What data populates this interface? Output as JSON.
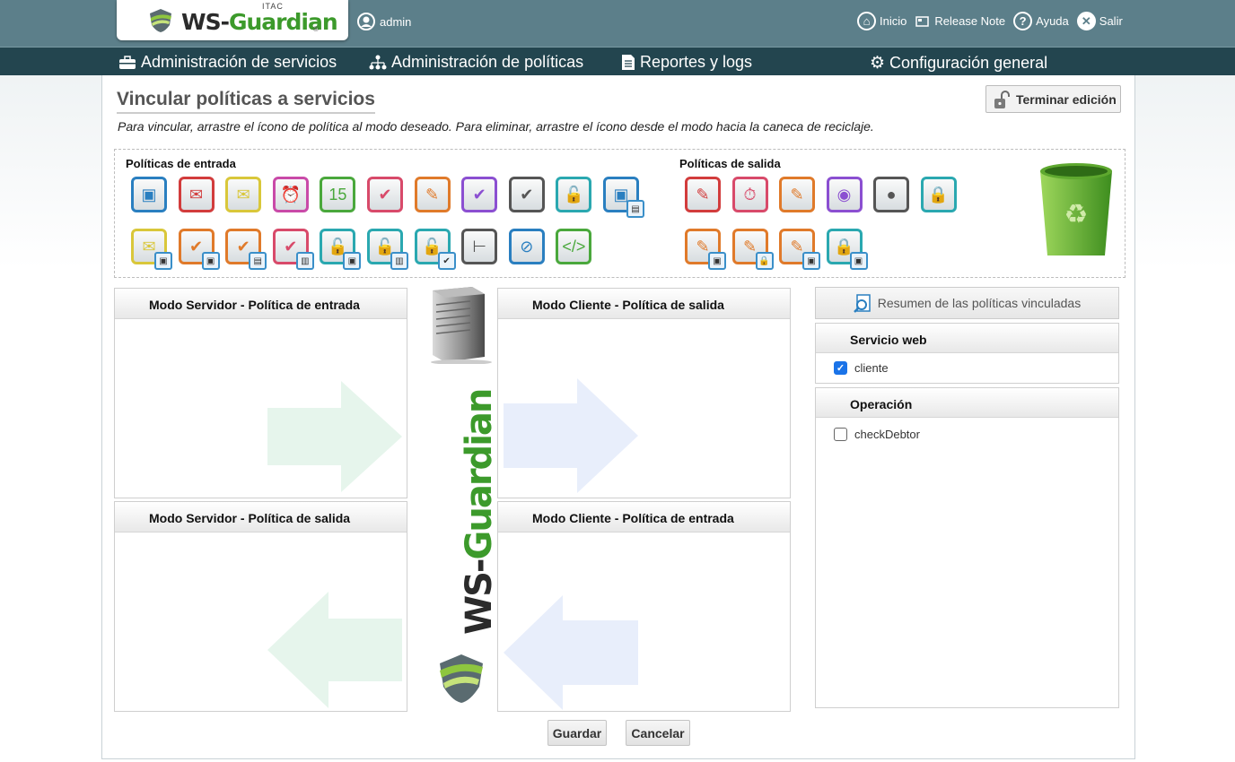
{
  "header": {
    "logo": {
      "itac": "ITAC",
      "ws": "WS-",
      "guardian": "Guardian",
      "reg": "®"
    },
    "user": "admin",
    "links": [
      {
        "label": "Inicio",
        "icon": "home-icon"
      },
      {
        "label": "Release Note",
        "icon": "note-icon"
      },
      {
        "label": "Ayuda",
        "icon": "help-icon"
      },
      {
        "label": "Salir",
        "icon": "close-icon"
      }
    ]
  },
  "nav": [
    {
      "label": "Administración de servicios",
      "icon": "briefcase-icon"
    },
    {
      "label": "Administración de políticas",
      "icon": "hierarchy-icon"
    },
    {
      "label": "Reportes y logs",
      "icon": "document-icon"
    },
    {
      "label": "Configuración general",
      "icon": "gear-icon"
    }
  ],
  "page": {
    "title": "Vincular políticas a servicios",
    "instructions": "Para vincular, arrastre el ícono de política al modo deseado. Para eliminar, arrastre el ícono desde el modo hacia la caneca de reciclaje.",
    "finish_edit": "Terminar edición"
  },
  "policies": {
    "input_label": "Políticas de entrada",
    "output_label": "Políticas de salida",
    "input_icons": [
      {
        "icon": "certificate-icon",
        "glyph": "▣",
        "color": "#2a7fc0",
        "sub": ""
      },
      {
        "icon": "stamp-icon",
        "glyph": "✉",
        "color": "#d23c3c",
        "sub": ""
      },
      {
        "icon": "envelope-icon",
        "glyph": "✉",
        "color": "#d9c73a",
        "sub": ""
      },
      {
        "icon": "alarm-clock-icon",
        "glyph": "⏰",
        "color": "#c94aa8",
        "sub": ""
      },
      {
        "icon": "calendar-icon",
        "glyph": "15",
        "color": "#4aa83c",
        "sub": ""
      },
      {
        "icon": "check-timer-icon",
        "glyph": "✔",
        "color": "#d84a6a",
        "sub": ""
      },
      {
        "icon": "signature-icon",
        "glyph": "✎",
        "color": "#e07a2a",
        "sub": ""
      },
      {
        "icon": "check-user-icon",
        "glyph": "✔",
        "color": "#8b4fd1",
        "sub": ""
      },
      {
        "icon": "check-person-icon",
        "glyph": "✔",
        "color": "#555555",
        "sub": ""
      },
      {
        "icon": "unlock-icon",
        "glyph": "🔓",
        "color": "#2aa8b0",
        "sub": ""
      },
      {
        "icon": "certificate-sub-icon",
        "glyph": "▣",
        "color": "#2a7fc0",
        "sub": "▤"
      },
      {
        "icon": "envelope-sub-icon",
        "glyph": "✉",
        "color": "#d9c73a",
        "sub": "▣"
      },
      {
        "icon": "check-sign-sub-icon",
        "glyph": "✔",
        "color": "#e07a2a",
        "sub": "▣"
      },
      {
        "icon": "check-sign-sub2-icon",
        "glyph": "✔",
        "color": "#e07a2a",
        "sub": "▤"
      },
      {
        "icon": "check-sign-sub3-icon",
        "glyph": "✔",
        "color": "#d84a6a",
        "sub": "▥"
      },
      {
        "icon": "unlock-sub-icon",
        "glyph": "🔓",
        "color": "#2aa8b0",
        "sub": "▣"
      },
      {
        "icon": "unlock-sub2-icon",
        "glyph": "🔓",
        "color": "#2aa8b0",
        "sub": "▥"
      },
      {
        "icon": "unlock-sign-sub-icon",
        "glyph": "🔓",
        "color": "#2aa8b0",
        "sub": "✔"
      },
      {
        "icon": "pipe-icon",
        "glyph": "⊢",
        "color": "#555555",
        "sub": ""
      },
      {
        "icon": "no-cert-icon",
        "glyph": "⊘",
        "color": "#2a7fc0",
        "sub": ""
      },
      {
        "icon": "xml-shield-icon",
        "glyph": "</>",
        "color": "#4aa83c",
        "sub": ""
      }
    ],
    "output_icons": [
      {
        "icon": "sign-cert-icon",
        "glyph": "✎",
        "color": "#d23c3c",
        "sub": ""
      },
      {
        "icon": "timer-icon",
        "glyph": "⏱",
        "color": "#d84a6a",
        "sub": ""
      },
      {
        "icon": "signature-out-icon",
        "glyph": "✎",
        "color": "#e07a2a",
        "sub": ""
      },
      {
        "icon": "user-circle-icon",
        "glyph": "◉",
        "color": "#8b4fd1",
        "sub": ""
      },
      {
        "icon": "person-icon",
        "glyph": "●",
        "color": "#555555",
        "sub": ""
      },
      {
        "icon": "lock-icon",
        "glyph": "🔒",
        "color": "#2aa8b0",
        "sub": ""
      },
      {
        "icon": "signature-sub-icon",
        "glyph": "✎",
        "color": "#e07a2a",
        "sub": "▣"
      },
      {
        "icon": "signature-lock-icon",
        "glyph": "✎",
        "color": "#e07a2a",
        "sub": "🔒"
      },
      {
        "icon": "signature-lock-sub-icon",
        "glyph": "✎",
        "color": "#e07a2a",
        "sub": "▣"
      },
      {
        "icon": "lock-sub-icon",
        "glyph": "🔒",
        "color": "#2aa8b0",
        "sub": "▣"
      }
    ]
  },
  "modes": {
    "server_in": "Modo Servidor - Política de entrada",
    "client_out": "Modo Cliente - Política de salida",
    "server_out": "Modo Servidor - Política de salida",
    "client_in": "Modo Cliente - Política de entrada"
  },
  "summary": {
    "button": "Resumen de las políticas vinculadas",
    "service_heading": "Servicio web",
    "service_item": "cliente",
    "service_checked": true,
    "operation_heading": "Operación",
    "operation_item": "checkDebtor",
    "operation_checked": false
  },
  "actions": {
    "save": "Guardar",
    "cancel": "Cancelar"
  },
  "colors": {
    "topbar": "#5c7f8a",
    "navbar": "#23454f",
    "brand_green": "#3c9a2b",
    "checkbox_blue": "#1a73e8"
  }
}
